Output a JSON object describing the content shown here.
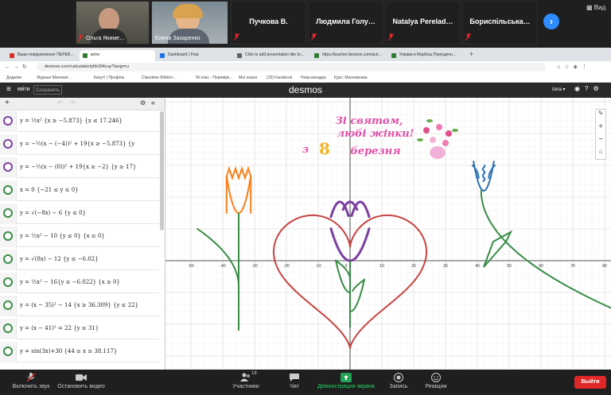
{
  "zoom": {
    "view_label": "Вид",
    "participants": [
      {
        "name": "Ольга Якиме…"
      },
      {
        "name": "Елена Захаренко"
      }
    ],
    "tiles": [
      {
        "name": "Пучкова В."
      },
      {
        "name": "Людмила Голу…"
      },
      {
        "name": "Natalya Perelad…"
      },
      {
        "name": "Бориспільська…"
      }
    ],
    "controls": {
      "audio": "Включить звук",
      "video": "Остановить видео",
      "participants": "Участники",
      "participants_count": "18",
      "chat": "Чат",
      "share": "Демонстрация экрана",
      "record": "Запись",
      "reactions": "Реакции",
      "exit": "Выйти"
    }
  },
  "browser": {
    "tabs": [
      {
        "label": "Ваше повідомлення: ПЕРЕВ…",
        "color": "#d93025"
      },
      {
        "label": "квіти",
        "color": "#2e7d32"
      },
      {
        "label": "Dashboard | Pear",
        "color": "#1a73e8"
      },
      {
        "label": "Click to add presentation title to…",
        "color": "#5f6368"
      },
      {
        "label": "https://teacher.desmos.com/acti…",
        "color": "#2e7d32"
      },
      {
        "label": "Управи в Марбош Періодичн…",
        "color": "#2e7d32"
      }
    ],
    "url": "desmos.com/calculator/pfdc5f4cuy?lang=ru",
    "bookmarks": [
      "Додатки",
      "Журнал Математ…",
      "Кахут! | Профіль",
      "Classtime Бібліот…",
      "7А клас - Перевірк…",
      "Мої класи",
      "(10) Facebook",
      "Нова вкладка",
      "Курс: Математика"
    ]
  },
  "desmos": {
    "graph_title": "квіти",
    "save_label": "Сохранить",
    "logo": "desmos",
    "user_label": "Iona",
    "expressions": [
      {
        "text": "y = ½x² {x ≥ −5.873} {x ≤ 17.246}",
        "color": "#7b3fa0"
      },
      {
        "text": "y = −½(x − (−4))² + 19{x ≥ −5.873} {y",
        "color": "#7b3fa0"
      },
      {
        "text": "y = −½(x − (0))² + 19{x ≥ −2} {y ≥ 17}",
        "color": "#7b3fa0"
      },
      {
        "text": "x = 0  {−21 ≤ y ≤ 0}",
        "color": "#388c46"
      },
      {
        "text": "y = √(−8x) − 6 {y ≤ 0}",
        "color": "#388c46"
      },
      {
        "text": "y = ½x² − 10 {y ≤ 0} {x ≤ 0}",
        "color": "#388c46"
      },
      {
        "text": "y = √(8x) − 12 {y ≤ −6.02}",
        "color": "#388c46"
      },
      {
        "text": "y = ½x² − 16{y ≤ −6.022} {x ≥ 0}",
        "color": "#388c46"
      },
      {
        "text": "y = (x − 35)² − 14 {x ≥ 36.309} {y ≤ 22}",
        "color": "#388c46"
      },
      {
        "text": "y = (x − 41)² = 22 {y ≤ 31}",
        "color": "#388c46"
      },
      {
        "text": "y = sin(3x)+30 {44 ≥ x ≥ 38.117}",
        "color": "#388c46"
      }
    ],
    "axis_x_ticks": [
      "-50",
      "-40",
      "-30",
      "-20",
      "-10",
      "0",
      "10",
      "20",
      "30",
      "40",
      "50",
      "60",
      "70",
      "80"
    ],
    "card_lines": [
      "Зі святом,",
      "любі жінки!",
      "з",
      "березня"
    ],
    "card_number": "8"
  },
  "colors": {
    "purple": "#7b3fa0",
    "green": "#388c46",
    "red": "#c74440",
    "orange": "#fa7e19",
    "blue": "#2d70b3"
  }
}
